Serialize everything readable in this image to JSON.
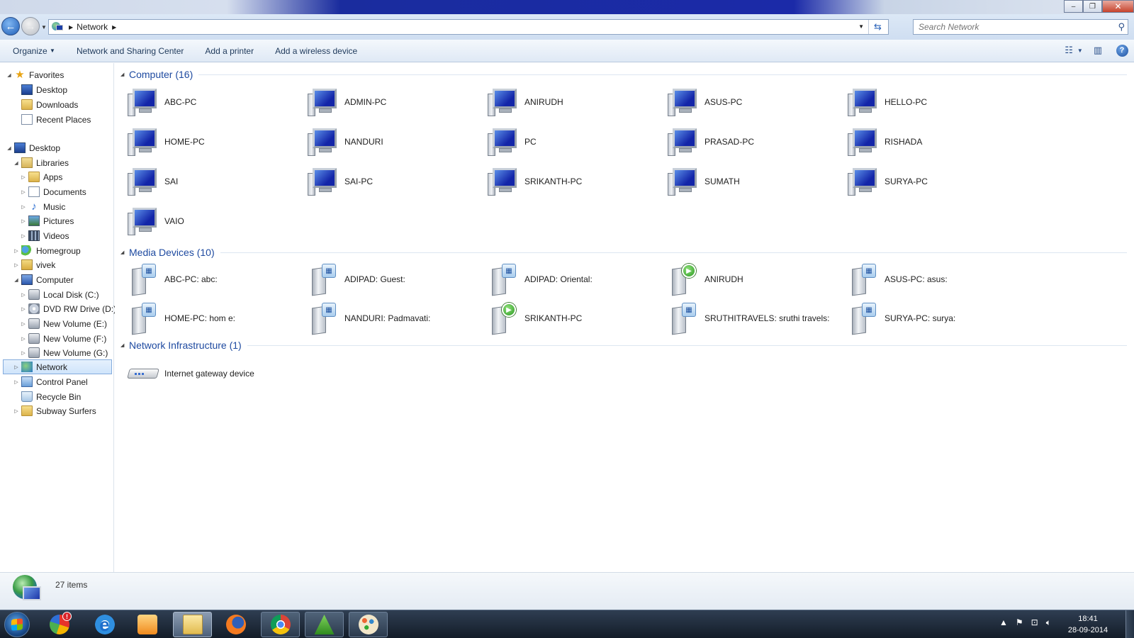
{
  "window": {
    "minimize": "–",
    "restore": "❐",
    "close": "✕"
  },
  "address": {
    "location": "Network",
    "search_placeholder": "Search Network"
  },
  "toolbar": {
    "organize": "Organize",
    "items": [
      "Network and Sharing Center",
      "Add a printer",
      "Add a wireless device"
    ]
  },
  "nav": {
    "favorites": "Favorites",
    "desktop1": "Desktop",
    "downloads": "Downloads",
    "recent": "Recent Places",
    "desktop": "Desktop",
    "libraries": "Libraries",
    "apps": "Apps",
    "documents": "Documents",
    "music": "Music",
    "pictures": "Pictures",
    "videos": "Videos",
    "homegroup": "Homegroup",
    "vivek": "vivek",
    "computer": "Computer",
    "c": "Local Disk (C:)",
    "d": "DVD RW Drive (D:)",
    "e": "New Volume (E:)",
    "f": "New Volume (F:)",
    "g": "New Volume (G:)",
    "network": "Network",
    "control": "Control Panel",
    "recycle": "Recycle Bin",
    "subway": "Subway Surfers"
  },
  "groups": {
    "computer": "Computer (16)",
    "media": "Media Devices (10)",
    "infra": "Network Infrastructure (1)"
  },
  "computers": [
    "ABC-PC",
    "ADMIN-PC",
    "ANIRUDH",
    "ASUS-PC",
    "HELLO-PC",
    "HOME-PC",
    "NANDURI",
    "PC",
    "PRASAD-PC",
    "RISHADA",
    "SAI",
    "SAI-PC",
    "SRIKANTH-PC",
    "SUMATH",
    "SURYA-PC",
    "VAIO"
  ],
  "media": [
    "ABC-PC: abc:",
    "ADIPAD: Guest:",
    "ADIPAD: Oriental:",
    "ANIRUDH",
    "ASUS-PC: asus:",
    "HOME-PC: hom e:",
    "NANDURI: Padmavati:",
    "SRIKANTH-PC",
    "SRUTHITRAVELS: sruthi travels:",
    "SURYA-PC: surya:"
  ],
  "infra": [
    "Internet gateway device"
  ],
  "status": {
    "count": "27 items"
  },
  "taskbar": {
    "badge": "!",
    "time": "18:41",
    "date": "28-09-2014"
  }
}
